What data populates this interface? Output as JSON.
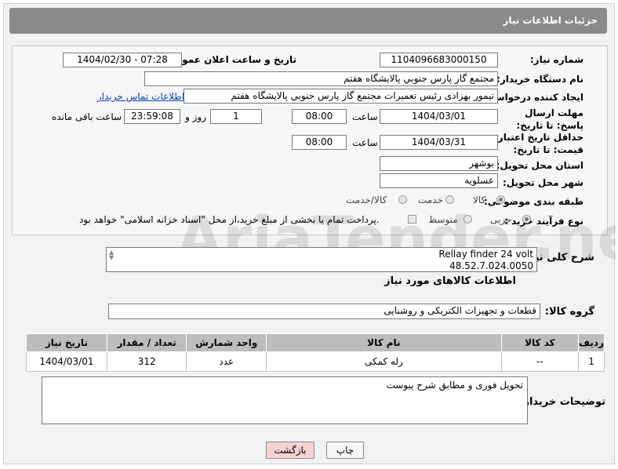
{
  "header": {
    "title": "جزئیات اطلاعات نیاز"
  },
  "form": {
    "need_number_label": "شماره نیاز:",
    "need_number": "1104096683000150",
    "announce_label": "تاریخ و ساعت اعلان عمومی:",
    "announce_value": "1404/02/30 - 07:28",
    "buyer_org_label": "نام دستگاه خریدار:",
    "buyer_org": "مجتمع گاز پارس جنوبي  پالايشگاه هفتم",
    "creator_label": "ایجاد کننده درخواست:",
    "creator": "تیمور بهزادی رئيس تعميرات مجتمع گاز پارس جنوبي  پالايشگاه هفتم",
    "contact_link": "اطلاعات تماس خریدار",
    "deadline_label": "مهلت ارسال پاسخ: تا تاریخ:",
    "deadline_date": "1404/03/01",
    "time_label": "ساعت",
    "deadline_time": "08:00",
    "days_value": "1",
    "days_label": "روز و",
    "remaining_time": "23:59:08",
    "remaining_label": "ساعت باقی مانده",
    "validity_label": "حداقل تاریخ اعتبار قیمت: تا تاریخ:",
    "validity_date": "1404/03/31",
    "validity_time": "08:00",
    "province_label": "استان محل تحویل:",
    "province": "بوشهر",
    "city_label": "شهر محل تحویل:",
    "city": "عسلویه",
    "category_label": "طبقه بندی موضوعی:",
    "category_options": [
      "کالا",
      "خدمت",
      "کالا/خدمت"
    ],
    "process_label": "نوع فرآیند خرید :",
    "process_options": [
      "جزیی",
      "متوسط"
    ],
    "payment_note": "پرداخت تمام یا بخشی از مبلغ خرید،از محل \"اسناد خزانه اسلامی\" خواهد بود."
  },
  "summary": {
    "label": "شرح کلی نیاز:",
    "line1": "Rellay finder 24 volt",
    "line2": "48.52.7.024.0050"
  },
  "goods": {
    "section_title": "اطلاعات کالاهای مورد نیاز",
    "group_label": "گروه کالا:",
    "group_value": "قطعات و تجهیزات الکتریکی و روشنایی",
    "columns": [
      "ردیف",
      "کد کالا",
      "نام کالا",
      "واحد شمارش",
      "تعداد / مقدار",
      "تاریخ نیاز"
    ],
    "rows": [
      {
        "row": "1",
        "code": "--",
        "name": "رله کمکی",
        "unit": "عدد",
        "qty": "312",
        "date": "1404/03/01"
      }
    ]
  },
  "notes": {
    "label": "توضیحات خریدار:",
    "value": "تحویل فوری و مطابق شرح پیوست"
  },
  "buttons": {
    "print": "چاپ",
    "back": "بازگشت"
  },
  "watermark": {
    "text": "AriaTender.neT"
  },
  "colors": {
    "header_bg": "#8a8a8a",
    "table_header_bg": "#bdbdbd",
    "link": "#0645ad",
    "back_button_bg": "#f6d3d3"
  }
}
